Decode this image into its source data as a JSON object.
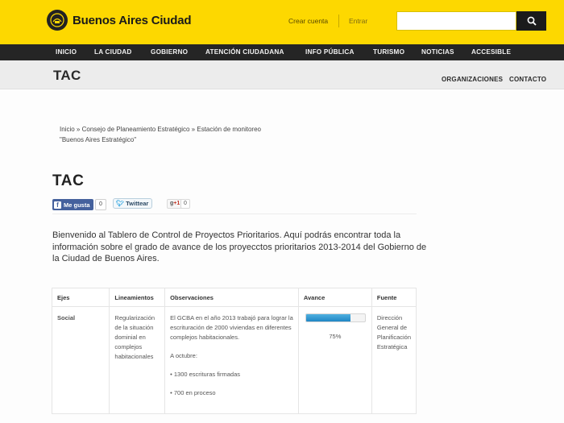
{
  "header": {
    "site_name": "Buenos Aires Ciudad",
    "register": "Crear cuenta",
    "login": "Entrar",
    "search_value": ""
  },
  "nav": [
    "INICIO",
    "LA CIUDAD",
    "GOBIERNO",
    "ATENCIÓN CIUDADANA",
    "INFO PÚBLICA",
    "TURISMO",
    "NOTICIAS",
    "ACCESIBLE"
  ],
  "subheader": {
    "title": "TAC",
    "links": [
      "ORGANIZACIONES",
      "CONTACTO"
    ]
  },
  "breadcrumb": {
    "items": [
      "Inicio",
      "Consejo de Planeamiento Estratégico",
      "Estación de monitoreo"
    ],
    "separator": " » ",
    "current": "\"Buenos Aires Estratégico\""
  },
  "page": {
    "title": "TAC",
    "intro": "Bienvenido al Tablero de Control de Proyectos Prioritarios. Aquí podrás encontrar toda la información sobre el grado de avance de los proyecctos prioritarios 2013-2014 del Gobierno de la Ciudad de Buenos Aires."
  },
  "social": {
    "facebook_label": "Me gusta",
    "facebook_count": "0",
    "twitter_label": "Twittear",
    "gplus_label": "+1",
    "gplus_count": "0"
  },
  "table": {
    "headers": [
      "Ejes",
      "Lineamientos",
      "Observaciones",
      "Avance",
      "Fuente"
    ],
    "rows": [
      {
        "eje": "Social",
        "lineamiento": "Regularización de la situación dominial en complejos habitacionales",
        "observaciones": [
          "El GCBA en el año 2013 trabajó para lograr la escrituración de 2000 viviendas en diferentes complejos habitacionales.",
          "A octubre:",
          "• 1300 escrituras firmadas",
          "• 700 en proceso"
        ],
        "avance_fraction": 0.75,
        "avance_label": "75%",
        "fuente": "Dirección General de Planificación Estratégica"
      }
    ]
  },
  "colors": {
    "brand_yellow": "#fdd800",
    "nav_dark": "#252525",
    "progress_blue": "#1f86c4"
  }
}
